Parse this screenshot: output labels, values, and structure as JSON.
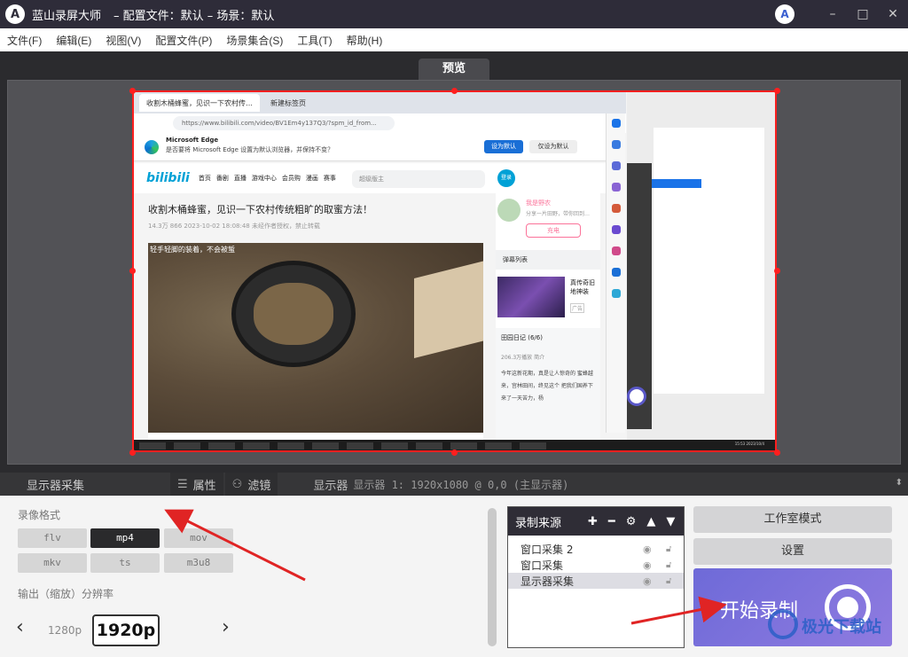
{
  "titlebar": {
    "app_name": "蓝山录屏大师",
    "info": "– 配置文件：默认 – 场景：默认",
    "logo_letter": "A",
    "brand_letter": "A",
    "minimize": "–",
    "maximize": "□",
    "close": "✕"
  },
  "menu": [
    "文件(F)",
    "编辑(E)",
    "视图(V)",
    "配置文件(P)",
    "场景集合(S)",
    "工具(T)",
    "帮助(H)"
  ],
  "preview": {
    "tab_label": "预览",
    "captured": {
      "tabs": [
        "收割木桶蜂蜜，见识一下农村传…",
        "新建标签页"
      ],
      "address": "https://www.bilibili.com/video/BV1Em4y137Q3/?spm_id_from...",
      "notice_title": "Microsoft Edge",
      "notice_text": "是否要将 Microsoft Edge 设置为默认浏览器，并保持不变？",
      "notice_btn_primary": "设为默认",
      "notice_btn_secondary": "仅设为默认",
      "bili_logo": "bilibili",
      "nav_links": [
        "首页",
        "番剧",
        "直播",
        "游戏中心",
        "会员购",
        "漫画",
        "赛事"
      ],
      "search_placeholder": "超级版主",
      "login": "登录",
      "video_title": "收割木桶蜂蜜，见识一下农村传统粗旷的取蜜方法！",
      "video_meta": "14.3万   866   2023-10-02 18:08:48   未经作者授权，禁止转载",
      "video_caption": "轻手轻脚的装着，不会被蜇",
      "up_name": "我是野农",
      "up_sub": "分享一片田野，带你回到…",
      "charge": "充电",
      "danmaku_list": "弹幕列表",
      "ad_title": "真传奇旧地神装",
      "ad_label": "广告",
      "diary_title": "田园日记 (6/6)",
      "diary_sub": "206.3万播放   简介",
      "diary_text": "今年这新花期，真是让人惊奇的 蜜蜂越来，宫林田间，终见这个 把我们国养下来了一天苦力，杨",
      "taskbar_time": "15:53 2023/10/4"
    }
  },
  "toolbar": {
    "source_label": "显示器采集",
    "props_label": "属性",
    "filter_label": "滤镜",
    "display_label": "显示器",
    "display_value": "显示器 1: 1920x1080 @ 0,0 (主显示器)"
  },
  "bottom": {
    "format_label": "录像格式",
    "formats": [
      "flv",
      "mp4",
      "mov",
      "mkv",
      "ts",
      "m3u8"
    ],
    "active_format": "mp4",
    "resolution_label": "输出（缩放）分辨率",
    "res_prev": "1280p",
    "res_current": "1920p",
    "sources_title": "录制来源",
    "sources": [
      "窗口采集 2",
      "窗口采集",
      "显示器采集"
    ],
    "selected_source": "显示器采集",
    "studio_mode": "工作室模式",
    "settings": "设置",
    "start_record": "开始录制",
    "watermark_text": "极光下载站"
  },
  "colors": {
    "accent": "#7a72dc",
    "selection": "#ff1f1f",
    "annotation": "#e02424"
  }
}
